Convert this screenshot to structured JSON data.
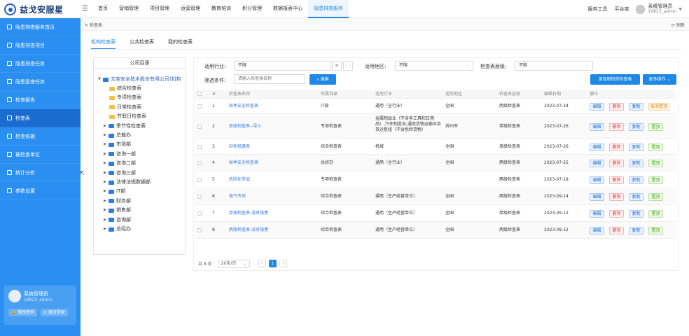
{
  "header": {
    "logo_text": "益戈安服星",
    "nav": [
      "首页",
      "营销管理",
      "项目管理",
      "运营管理",
      "教育培训",
      "积分管理",
      "数据报表中心",
      "隐患排查服务"
    ],
    "tools": [
      "服务工具",
      "平台库"
    ],
    "user_name": "系统管理员",
    "user_id": "19823_admin"
  },
  "sidebar": {
    "items": [
      "隐患排查服务首页",
      "隐患排查项目",
      "隐患排查任务",
      "隐患复查任务",
      "检查报告",
      "检查表",
      "检查依据",
      "被检查单位",
      "统计分析",
      "参数设置"
    ],
    "active_index": 5,
    "user_name": "系统管理员",
    "user_id": "19823_admin",
    "btn_password": "修改密码",
    "btn_logout": "退出登录"
  },
  "crumb": {
    "text": "检查表",
    "refresh": "刷新"
  },
  "tabs": [
    "机构检查表",
    "公共检查表",
    "我的检查表"
  ],
  "tree": {
    "title": "公司目录",
    "root": "文库安全技术股份有限公司(机构",
    "rows": [
      {
        "label": "综合检查表",
        "type": "y",
        "arrow": false
      },
      {
        "label": "专项检查表",
        "type": "y",
        "arrow": false
      },
      {
        "label": "日常检查表",
        "type": "y",
        "arrow": false
      },
      {
        "label": "节假日检查表",
        "type": "y",
        "arrow": false
      },
      {
        "label": "季节性检查表",
        "type": "b",
        "arrow": true
      },
      {
        "label": "总裁办",
        "type": "b",
        "arrow": true
      },
      {
        "label": "市场部",
        "type": "b",
        "arrow": true
      },
      {
        "label": "咨询一部",
        "type": "b",
        "arrow": true
      },
      {
        "label": "咨询二部",
        "type": "b",
        "arrow": true
      },
      {
        "label": "咨询三部",
        "type": "b",
        "arrow": true
      },
      {
        "label": "法律法规数据部",
        "type": "b",
        "arrow": true
      },
      {
        "label": "IT部",
        "type": "b",
        "arrow": true
      },
      {
        "label": "财务部",
        "type": "b",
        "arrow": true
      },
      {
        "label": "销售部",
        "type": "b",
        "arrow": true
      },
      {
        "label": "咨询部",
        "type": "b",
        "arrow": true
      },
      {
        "label": "总经办",
        "type": "b",
        "arrow": true
      }
    ]
  },
  "filters": {
    "industry_label": "适用行业:",
    "industry_value": "不限",
    "region_label": "适用地区:",
    "region_value": "不限",
    "level_label": "检查表层级:",
    "level_value": "不限",
    "cond_label": "筛选条件:",
    "cond_placeholder": "请输入检查表名称",
    "search_btn": "搜索",
    "add_btn": "添加制检的检查表",
    "more_btn": "更多操作"
  },
  "table": {
    "headers": [
      "#",
      "检查表名称",
      "所属目录",
      "适用行业",
      "适用地区",
      "检查表层级",
      "编辑日期",
      "操作"
    ],
    "rows": [
      {
        "no": "1",
        "name": "秋季安全检查表",
        "dir": "IT部",
        "industry": "通用（全行业）",
        "region": "全国",
        "level": "两级检查表",
        "date": "2023-07-24",
        "actions": [
          "编辑",
          "删除",
          "复制",
          "取消置顶"
        ]
      },
      {
        "no": "2",
        "name": "单级检查表--导入",
        "dir": "专项检查表",
        "industry": "金属制品业（不含手工具和日用品）,汽车制造业,通用货物运输业及货运枢纽（不含危险货物）",
        "region": "苏州市",
        "level": "单级检查表",
        "date": "2023-07-26",
        "actions": [
          "编辑",
          "删除",
          "复制",
          "置顶"
        ]
      },
      {
        "no": "3",
        "name": "砂轮机器表",
        "dir": "综合检查表",
        "industry": "机械",
        "region": "全国",
        "level": "单级检查表",
        "date": "2023-07-26",
        "actions": [
          "编辑",
          "删除",
          "复制",
          "置顶"
        ]
      },
      {
        "no": "4",
        "name": "秋季安全检查表",
        "dir": "总经办",
        "industry": "通用（全行业）",
        "region": "全国",
        "level": "两级检查表",
        "date": "2023-07-25",
        "actions": [
          "编辑",
          "删除",
          "复制",
          "置顶"
        ]
      },
      {
        "no": "5",
        "name": "危险化学品",
        "dir": "专项检查表",
        "industry": "",
        "region": "",
        "level": "两级检查表",
        "date": "2023-07-19",
        "actions": [
          "编辑",
          "删除",
          "复制",
          "置顶"
        ]
      },
      {
        "no": "6",
        "name": "电气专项",
        "dir": "综合检查表",
        "industry": "通用（生产经营单位）",
        "region": "全国",
        "level": "两级检查表",
        "date": "2023-09-14",
        "actions": [
          "编辑",
          "删除",
          "复制",
          "置顶"
        ]
      },
      {
        "no": "7",
        "name": "单级检查表-没有隐患",
        "dir": "综合检查表",
        "industry": "通用（生产经营单位）",
        "region": "全国",
        "level": "单级检查表",
        "date": "2023-09-12",
        "actions": [
          "编辑",
          "删除",
          "复制",
          "置顶"
        ]
      },
      {
        "no": "8",
        "name": "两级检查表-没有隐患",
        "dir": "综合检查表",
        "industry": "通用（生产经营单位）",
        "region": "全国",
        "level": "两级检查表",
        "date": "2023-09-12",
        "actions": [
          "编辑",
          "删除",
          "复制",
          "置顶"
        ]
      }
    ]
  },
  "pager": {
    "total": "共 8 条",
    "size": "20条/页",
    "current": "1"
  }
}
